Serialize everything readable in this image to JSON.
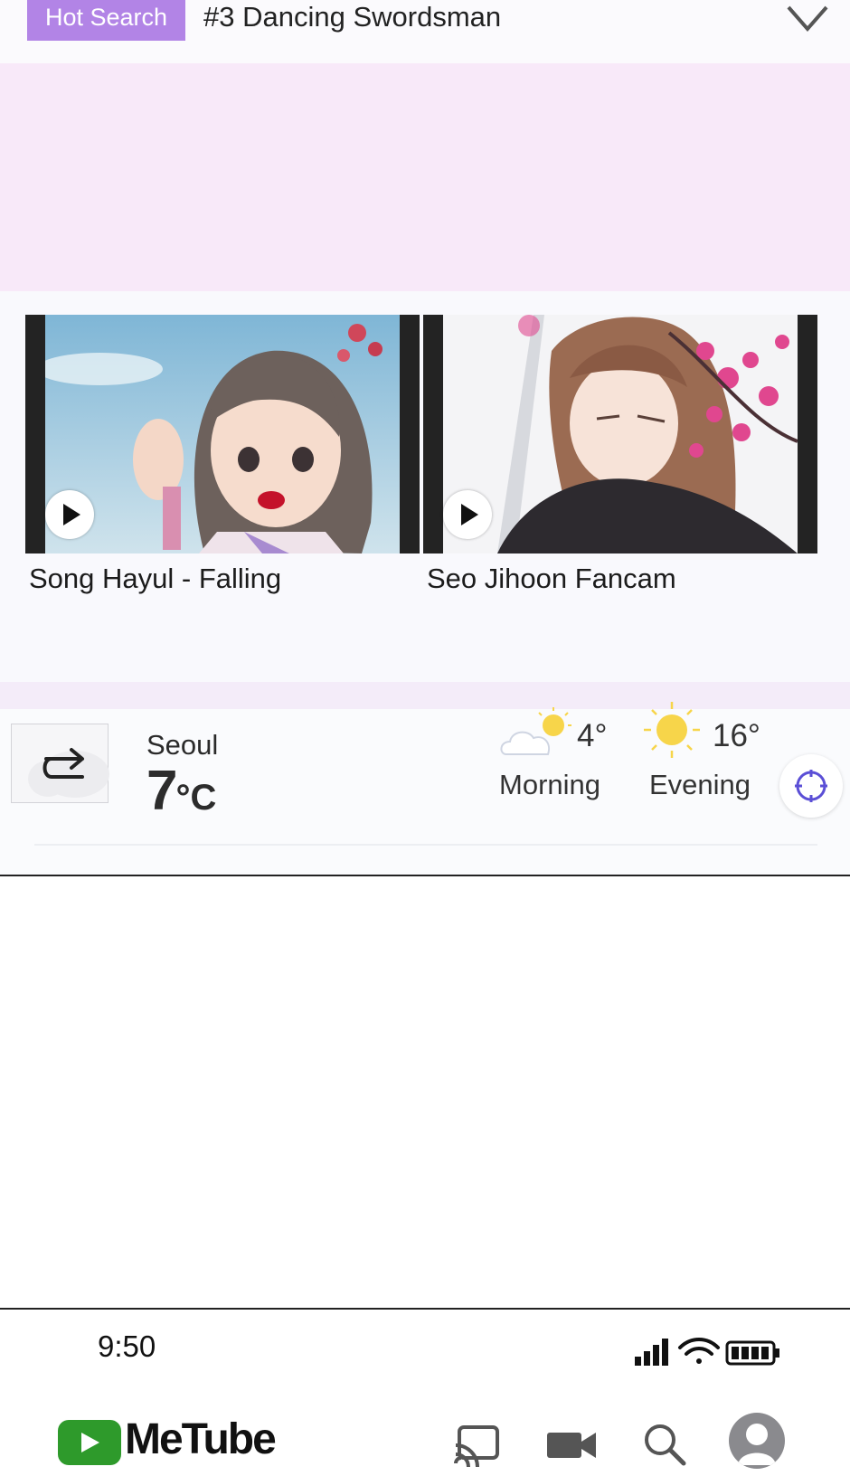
{
  "hot_search": {
    "badge": "Hot Search",
    "text": "#3 Dancing Swordsman"
  },
  "videos": [
    {
      "title": "Song Hayul - Falling"
    },
    {
      "title": "Seo Jihoon Fancam"
    }
  ],
  "weather": {
    "city": "Seoul",
    "temp_value": "7",
    "temp_unit": "°C",
    "forecast": [
      {
        "temp": "4°",
        "label": "Morning",
        "icon": "partly-cloudy-icon"
      },
      {
        "temp": "16°",
        "label": "Evening",
        "icon": "sun-icon"
      }
    ]
  },
  "status_bar": {
    "time": "9:50"
  },
  "app_bar": {
    "logo_text": "MeTube",
    "icons": [
      "cast-icon",
      "video-camera-icon",
      "search-icon",
      "avatar"
    ]
  },
  "colors": {
    "hot_badge": "#b284e6",
    "ad_banner": "#f8e9f9",
    "logo_green": "#2e9a2b",
    "locate_icon": "#5b4fd6"
  }
}
